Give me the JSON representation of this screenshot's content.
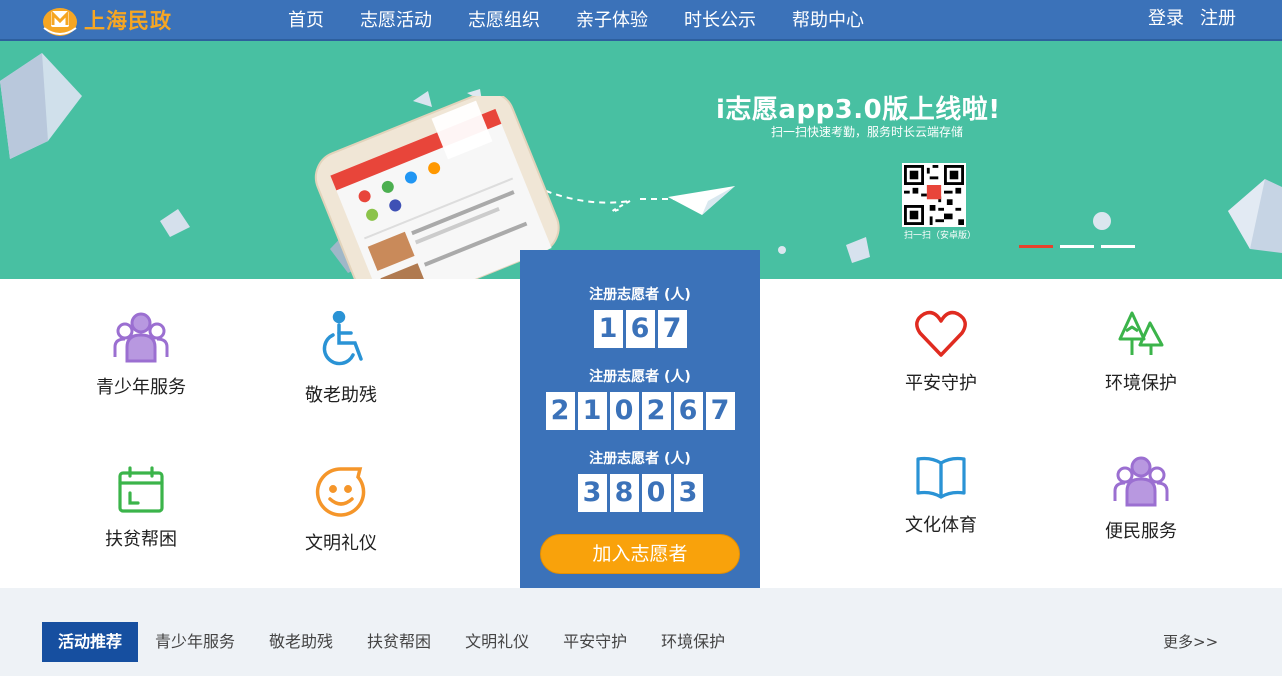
{
  "header": {
    "logo_text": "上海民政",
    "nav": [
      "首页",
      "志愿活动",
      "志愿组织",
      "亲子体验",
      "时长公示",
      "帮助中心"
    ],
    "login": "登录",
    "register": "注册"
  },
  "banner": {
    "title": "i志愿app3.0版上线啦!",
    "subtitle": "扫一扫快速考勤，服务时长云端存储",
    "qr_caption": "扫一扫（安卓版）",
    "slides": 3,
    "active_slide": 1
  },
  "services": {
    "youth": "青少年服务",
    "elderly": "敬老助残",
    "poverty": "扶贫帮困",
    "etiquette": "文明礼仪",
    "safety": "平安守护",
    "environment": "环境保护",
    "culture": "文化体育",
    "convenience": "便民服务"
  },
  "stats": {
    "items": [
      {
        "label": "注册志愿者 (人)",
        "digits": [
          "1",
          "6",
          "7"
        ]
      },
      {
        "label": "注册志愿者 (人)",
        "digits": [
          "2",
          "1",
          "0",
          "2",
          "6",
          "7"
        ]
      },
      {
        "label": "注册志愿者 (人)",
        "digits": [
          "3",
          "8",
          "0",
          "3"
        ]
      }
    ],
    "join_label": "加入志愿者"
  },
  "activity": {
    "tabs": [
      "活动推荐",
      "青少年服务",
      "敬老助残",
      "扶贫帮困",
      "文明礼仪",
      "平安守护",
      "环境保护"
    ],
    "more": "更多>>"
  },
  "colors": {
    "header_bg": "#3b72b9",
    "banner_bg": "#48c0a2",
    "accent_orange": "#f9a20b",
    "active_tab": "#164fa0"
  }
}
